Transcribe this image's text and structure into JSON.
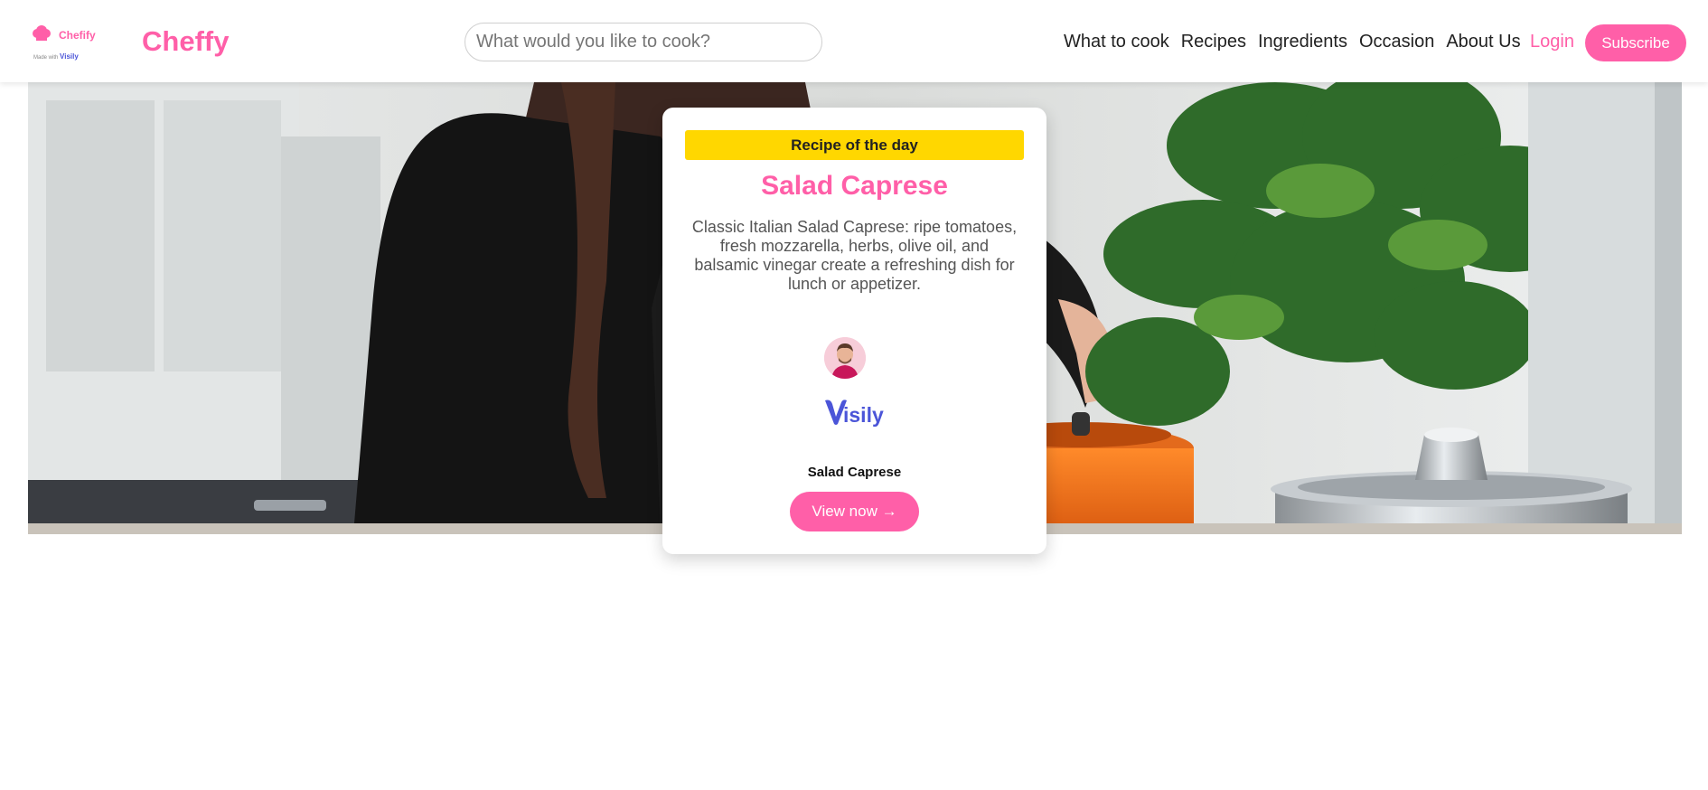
{
  "header": {
    "logo": {
      "name": "Chefify",
      "made_with": "Made with",
      "made_with_brand": "Visily"
    },
    "brand": "Cheffy",
    "search": {
      "placeholder": "What would you like to cook?",
      "value": ""
    },
    "nav": [
      {
        "label": "What to cook"
      },
      {
        "label": "Recipes"
      },
      {
        "label": "Ingredients"
      },
      {
        "label": "Occasion"
      },
      {
        "label": "About Us"
      }
    ],
    "login_label": "Login",
    "subscribe_label": "Subscribe"
  },
  "recipe_card": {
    "badge": "Recipe of the day",
    "title": "Salad Caprese",
    "description": "Classic Italian Salad Caprese: ripe tomatoes, fresh mozzarella, herbs, olive oil, and balsamic vinegar create a refreshing dish for lunch or appetizer.",
    "brand_logo": "Visily",
    "name": "Salad Caprese",
    "cta_label": "View now →"
  },
  "colors": {
    "accent": "#ff5fa8",
    "badge": "#ffd700",
    "visily": "#4b55d8"
  },
  "icons": {
    "logo": "chef-hat-icon",
    "avatar": "user-avatar",
    "cta": "arrow-right-icon"
  }
}
